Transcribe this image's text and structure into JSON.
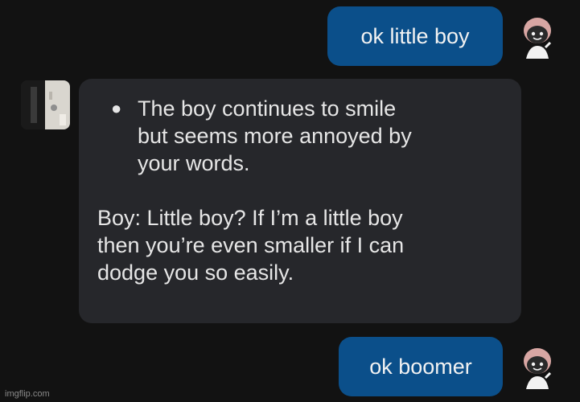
{
  "messages": {
    "first_user": "ok little boy",
    "bot_action": "The boy continues to smile\nbut seems more annoyed by\nyour words.",
    "bot_speech": "Boy: Little boy? If I’m a little boy\nthen you’re even smaller if I can\ndodge you so easily.",
    "second_user": "ok boomer"
  },
  "avatars": {
    "user": "chibi-character-avatar",
    "bot": "door-photo-avatar"
  },
  "watermark": "imgflip.com",
  "colors": {
    "background": "#121212",
    "user_bubble": "#0b4f8a",
    "bot_bubble": "#26272b",
    "text": "#e6e6e6"
  }
}
